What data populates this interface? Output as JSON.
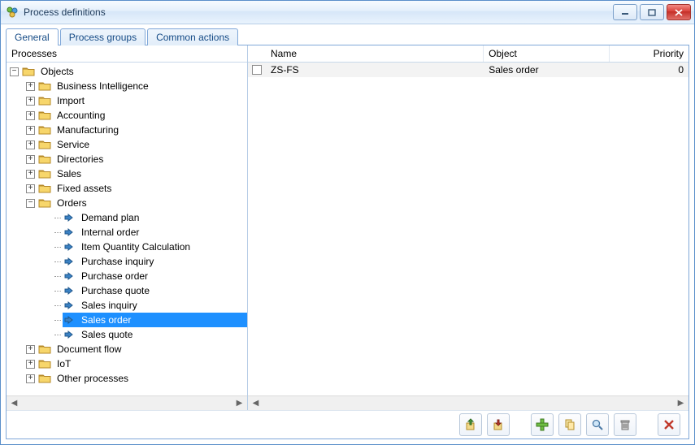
{
  "title": "Process definitions",
  "tabs": [
    {
      "label": "General",
      "active": true
    },
    {
      "label": "Process groups",
      "active": false
    },
    {
      "label": "Common actions",
      "active": false
    }
  ],
  "left": {
    "header": "Processes",
    "tree": [
      {
        "depth": 0,
        "toggle": "minus",
        "icon": "folder",
        "label": "Objects",
        "selected": false
      },
      {
        "depth": 1,
        "toggle": "plus",
        "icon": "folder",
        "label": "Business Intelligence",
        "selected": false
      },
      {
        "depth": 1,
        "toggle": "plus",
        "icon": "folder",
        "label": "Import",
        "selected": false
      },
      {
        "depth": 1,
        "toggle": "plus",
        "icon": "folder",
        "label": "Accounting",
        "selected": false
      },
      {
        "depth": 1,
        "toggle": "plus",
        "icon": "folder",
        "label": "Manufacturing",
        "selected": false
      },
      {
        "depth": 1,
        "toggle": "plus",
        "icon": "folder",
        "label": "Service",
        "selected": false
      },
      {
        "depth": 1,
        "toggle": "plus",
        "icon": "folder",
        "label": "Directories",
        "selected": false
      },
      {
        "depth": 1,
        "toggle": "plus",
        "icon": "folder",
        "label": "Sales",
        "selected": false
      },
      {
        "depth": 1,
        "toggle": "plus",
        "icon": "folder",
        "label": "Fixed assets",
        "selected": false
      },
      {
        "depth": 1,
        "toggle": "minus",
        "icon": "folder",
        "label": "Orders",
        "selected": false
      },
      {
        "depth": 2,
        "toggle": "none",
        "icon": "doc",
        "label": "Demand plan",
        "selected": false
      },
      {
        "depth": 2,
        "toggle": "none",
        "icon": "doc",
        "label": "Internal order",
        "selected": false
      },
      {
        "depth": 2,
        "toggle": "none",
        "icon": "doc",
        "label": "Item Quantity Calculation",
        "selected": false
      },
      {
        "depth": 2,
        "toggle": "none",
        "icon": "doc",
        "label": "Purchase inquiry",
        "selected": false
      },
      {
        "depth": 2,
        "toggle": "none",
        "icon": "doc",
        "label": "Purchase order",
        "selected": false
      },
      {
        "depth": 2,
        "toggle": "none",
        "icon": "doc",
        "label": "Purchase quote",
        "selected": false
      },
      {
        "depth": 2,
        "toggle": "none",
        "icon": "doc",
        "label": "Sales inquiry",
        "selected": false
      },
      {
        "depth": 2,
        "toggle": "none",
        "icon": "doc",
        "label": "Sales order",
        "selected": true
      },
      {
        "depth": 2,
        "toggle": "none",
        "icon": "doc",
        "label": "Sales quote",
        "selected": false
      },
      {
        "depth": 1,
        "toggle": "plus",
        "icon": "folder",
        "label": "Document flow",
        "selected": false
      },
      {
        "depth": 1,
        "toggle": "plus",
        "icon": "folder",
        "label": "IoT",
        "selected": false
      },
      {
        "depth": 1,
        "toggle": "plus",
        "icon": "folder",
        "label": "Other processes",
        "selected": false
      }
    ]
  },
  "right": {
    "columns": {
      "name": "Name",
      "object": "Object",
      "priority": "Priority"
    },
    "rows": [
      {
        "checked": false,
        "name": "ZS-FS",
        "object": "Sales order",
        "priority": "0"
      }
    ]
  },
  "toolbar": {
    "export": "export",
    "import": "import",
    "add": "add",
    "copy": "copy",
    "find": "find",
    "delete": "delete",
    "close": "close"
  }
}
